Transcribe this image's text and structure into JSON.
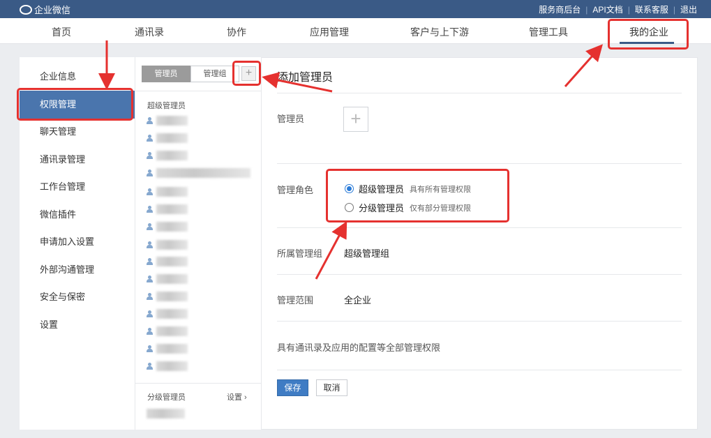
{
  "topbar": {
    "logo_text": "企业微信",
    "links": [
      "服务商后台",
      "API文档",
      "联系客服",
      "退出"
    ]
  },
  "mainnav": {
    "items": [
      "首页",
      "通讯录",
      "协作",
      "应用管理",
      "客户与上下游",
      "管理工具",
      "我的企业"
    ],
    "active": "我的企业"
  },
  "sidebar": {
    "items": [
      "企业信息",
      "权限管理",
      "聊天管理",
      "通讯录管理",
      "工作台管理",
      "微信插件",
      "申请加入设置",
      "外部沟通管理",
      "安全与保密",
      "设置"
    ],
    "active": "权限管理"
  },
  "middle": {
    "tabs": [
      "管理员",
      "管理组"
    ],
    "active_tab": "管理员",
    "add_icon": "plus-icon",
    "super_admin_label": "超级管理员",
    "sub_admin_label": "分级管理员",
    "settings_link": "设置 ›"
  },
  "form": {
    "title": "添加管理员",
    "admin_label": "管理员",
    "role_label": "管理角色",
    "roles": [
      {
        "name": "超级管理员",
        "desc": "具有所有管理权限",
        "checked": true
      },
      {
        "name": "分级管理员",
        "desc": "仅有部分管理权限",
        "checked": false
      }
    ],
    "group_label": "所属管理组",
    "group_value": "超级管理组",
    "scope_label": "管理范围",
    "scope_value": "全企业",
    "description": "具有通讯录及应用的配置等全部管理权限",
    "save_label": "保存",
    "cancel_label": "取消"
  },
  "colors": {
    "topbar": "#3a5a86",
    "sidebar_active": "#4a75ad",
    "primary_button": "#3f7cc4",
    "annotation_red": "#e5312f"
  }
}
